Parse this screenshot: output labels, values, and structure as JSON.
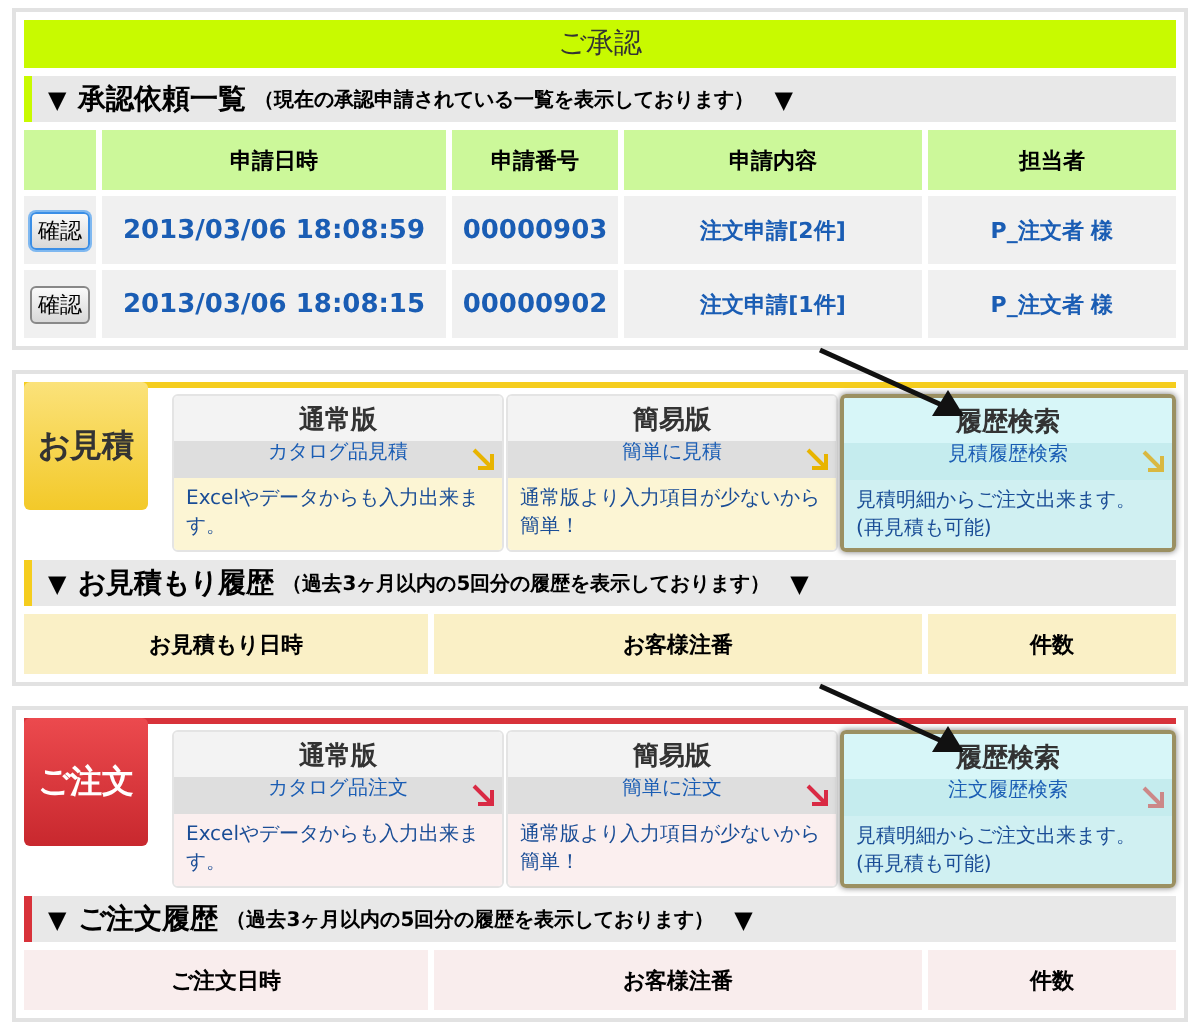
{
  "approval": {
    "title": "ご承認",
    "header": {
      "toggle": "▼",
      "title": "承認依頼一覧",
      "note": "（現在の承認申請されている一覧を表示しております）",
      "toggle_end": "▼"
    },
    "columns": [
      "申請日時",
      "申請番号",
      "申請内容",
      "担当者"
    ],
    "rows": [
      {
        "button": "確認",
        "focused": true,
        "date": "2013/03/06 18:08:59",
        "number": "00000903",
        "content": "注文申請[2件]",
        "person": "P_注文者 様"
      },
      {
        "button": "確認",
        "focused": false,
        "date": "2013/03/06 18:08:15",
        "number": "00000902",
        "content": "注文申請[1件]",
        "person": "P_注文者 様"
      }
    ]
  },
  "sections": [
    {
      "kind": "quote",
      "label": "お見積",
      "tiles": [
        {
          "title": "通常版",
          "subtitle": "カタログ品見積",
          "description": "Excelやデータからも入力出来ます。",
          "highlighted": false
        },
        {
          "title": "簡易版",
          "subtitle": "簡単に見積",
          "description": "通常版より入力項目が少ないから簡単！",
          "highlighted": false
        },
        {
          "title": "履歴検索",
          "subtitle": "見積履歴検索",
          "description": "見積明細からご注文出来ます。(再見積も可能)",
          "highlighted": true
        }
      ],
      "header": {
        "toggle": "▼",
        "title": "お見積もり履歴",
        "note": "（過去3ヶ月以内の5回分の履歴を表示しております）",
        "toggle_end": "▼"
      },
      "columns": [
        "お見積もり日時",
        "お客様注番",
        "件数"
      ]
    },
    {
      "kind": "order",
      "label": "ご注文",
      "tiles": [
        {
          "title": "通常版",
          "subtitle": "カタログ品注文",
          "description": "Excelやデータからも入力出来ます。",
          "highlighted": false
        },
        {
          "title": "簡易版",
          "subtitle": "簡単に注文",
          "description": "通常版より入力項目が少ないから簡単！",
          "highlighted": false
        },
        {
          "title": "履歴検索",
          "subtitle": "注文履歴検索",
          "description": "見積明細からご注文出来ます。(再見積も可能)",
          "highlighted": true
        }
      ],
      "header": {
        "toggle": "▼",
        "title": "ご注文履歴",
        "note": "（過去3ヶ月以内の5回分の履歴を表示しております）",
        "toggle_end": "▼"
      },
      "columns": [
        "ご注文日時",
        "お客様注番",
        "件数"
      ]
    }
  ]
}
